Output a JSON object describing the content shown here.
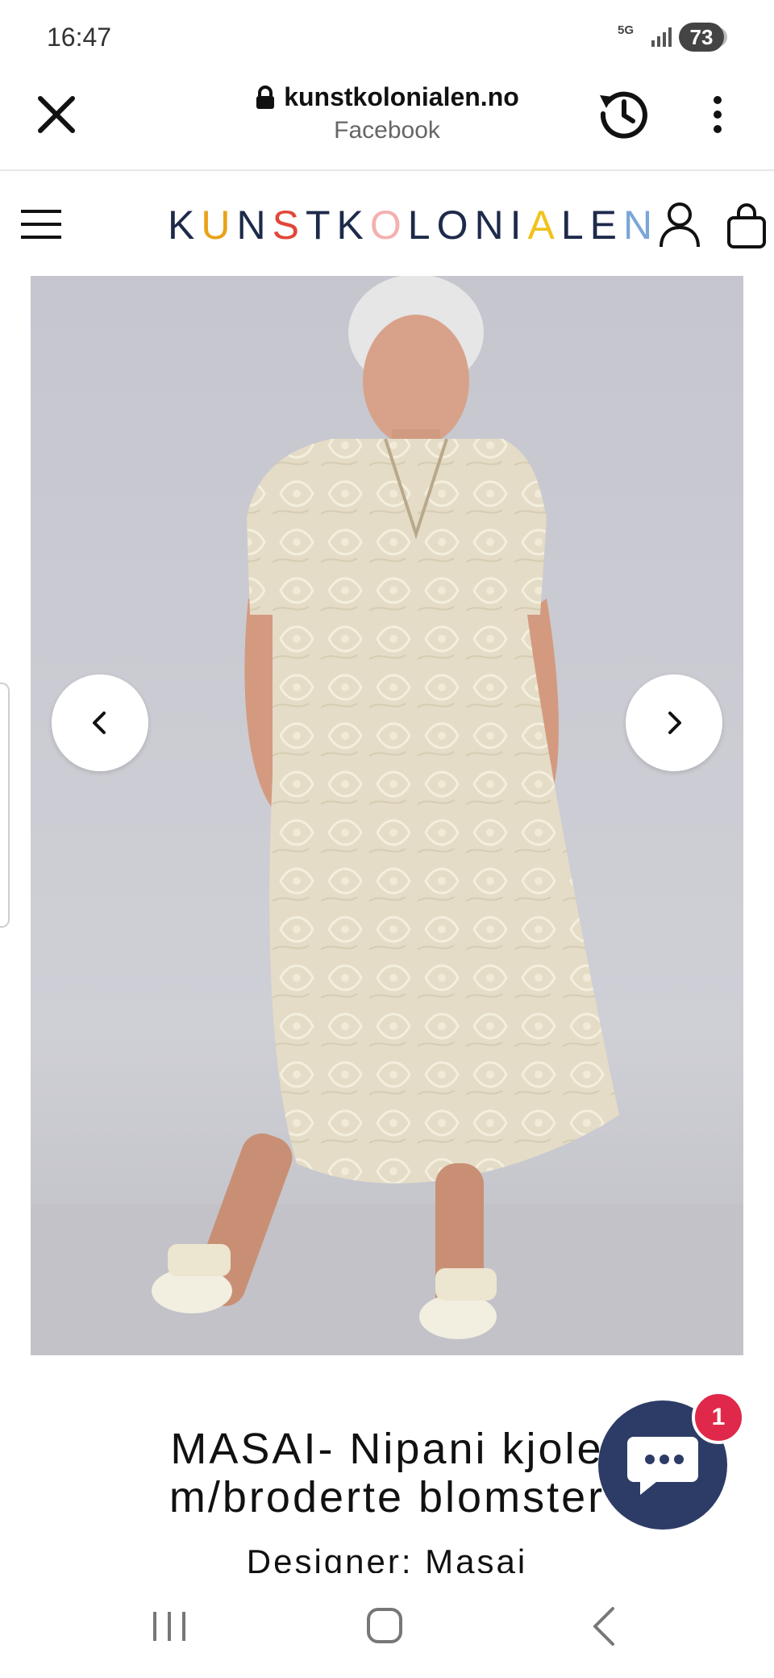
{
  "status_bar": {
    "time": "16:47",
    "network": "5G",
    "battery": "73"
  },
  "browser": {
    "domain": "kunstkolonialen.no",
    "source": "Facebook"
  },
  "site": {
    "logo_letters": [
      "K",
      "U",
      "N",
      "S",
      "T",
      "K",
      "O",
      "L",
      "O",
      "N",
      "I",
      "A",
      "L",
      "E",
      "N"
    ],
    "logo_colors": [
      "#1d2a4a",
      "#e8a21a",
      "#1d2a4a",
      "#e2463a",
      "#1d2a4a",
      "#1d2a4a",
      "#f3b1b0",
      "#1d2a4a",
      "#1d2a4a",
      "#1d2a4a",
      "#1d2a4a",
      "#f0c21a",
      "#1d2a4a",
      "#1d2a4a",
      "#7aa6d8"
    ]
  },
  "product": {
    "title": "MASAI- Nipani kjole m/broderte blomster",
    "designer": "Designer: Masai"
  },
  "chat": {
    "badge_count": "1"
  },
  "colors": {
    "chat_bg": "#2c3c66",
    "badge_bg": "#e0294a",
    "photo_bg": "#c9c9d2"
  }
}
